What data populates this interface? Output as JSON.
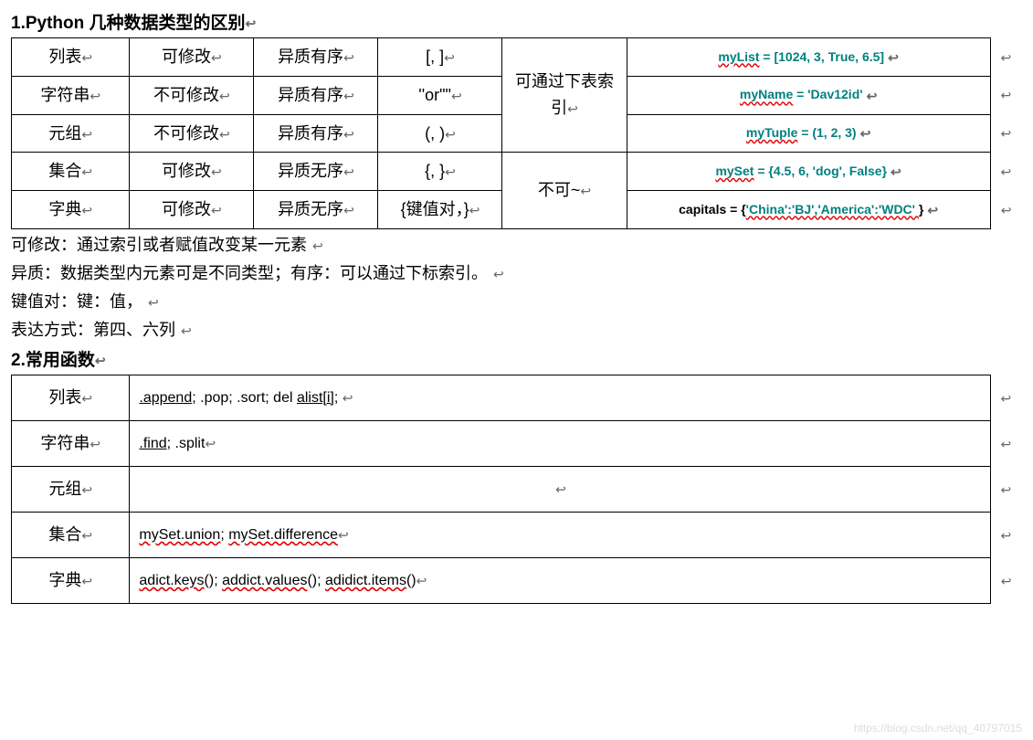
{
  "heading1": "1.Python 几种数据类型的区别",
  "heading1_ret": "↩",
  "table1": {
    "rows": [
      {
        "name": "列表",
        "mutable": "可修改",
        "order": "异质有序",
        "syntax": "[, ]",
        "indexable": "可通过下表索引",
        "example_prefix": "myList",
        "example_rest": " = [1024, 3, True, 6.5]"
      },
      {
        "name": "字符串",
        "mutable": "不可修改",
        "order": "异质有序",
        "syntax": "''or\"\"",
        "example_prefix": "myName",
        "example_rest": " = 'Dav12id'"
      },
      {
        "name": "元组",
        "mutable": "不可修改",
        "order": "异质有序",
        "syntax": "(, )",
        "example_prefix": "myTuple",
        "example_rest": " = (1, 2, 3)"
      },
      {
        "name": "集合",
        "mutable": "可修改",
        "order": "异质无序",
        "syntax": "{, }",
        "indexable": "不可~",
        "example_prefix": "mySet",
        "example_rest": " = {4.5, 6, 'dog', False}"
      },
      {
        "name": "字典",
        "mutable": "可修改",
        "order": "异质无序",
        "syntax_text": "{键值对，}",
        "example_normal_prefix": "capitals = {",
        "example_colored": "'China':'BJ','America':'WDC' ",
        "example_normal_suffix": "}"
      }
    ]
  },
  "notes": {
    "n1": "可修改：通过索引或者赋值改变某一元素",
    "n2": "异质：数据类型内元素可是不同类型；有序：可以通过下标索引。",
    "n3": "键值对：键：值，",
    "n4": "表达方式：第四、六列"
  },
  "heading2": "2.常用函数",
  "table2": {
    "rows": [
      {
        "name": "列表",
        "funcs_u1": ".append",
        "funcs_mid": "; .pop; .sort; del ",
        "funcs_u2": "alist[i]",
        "funcs_end": ";  "
      },
      {
        "name": "字符串",
        "funcs_u1": ".find",
        "funcs_mid": "; .split"
      },
      {
        "name": "元组",
        "empty": true
      },
      {
        "name": "集合",
        "funcs_sq1": "mySet.union",
        "funcs_mid": "; ",
        "funcs_sq2": "mySet.difference"
      },
      {
        "name": "字典",
        "funcs_sq1": "adict.keys",
        "funcs_p1": "(); ",
        "funcs_sq2": "addict.values",
        "funcs_p2": "(); ",
        "funcs_sq3": "adidict.items",
        "funcs_p3": "()"
      }
    ]
  },
  "ret_symbol": "↩",
  "watermark": "https://blog.csdn.net/qq_40797015"
}
